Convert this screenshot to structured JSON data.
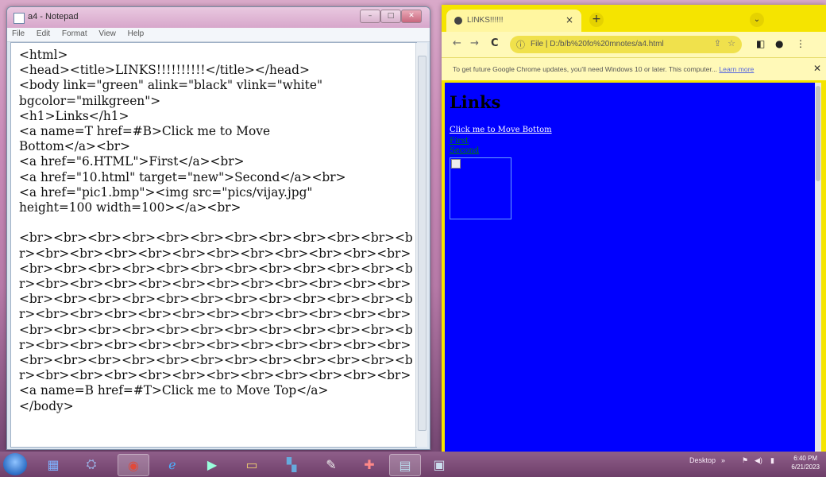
{
  "notepad": {
    "title": "a4 - Notepad",
    "menu": [
      "File",
      "Edit",
      "Format",
      "View",
      "Help"
    ],
    "controls": [
      "–",
      "□",
      "✕"
    ],
    "content": "<html>\n<head><title>LINKS!!!!!!!!!!</title></head>\n<body link=\"green\" alink=\"black\" vlink=\"white\"\nbgcolor=\"milkgreen\">\n<h1>Links</h1>\n<a name=T href=#B>Click me to Move\nBottom</a><br>\n<a href=\"6.HTML\">First</a><br>\n<a href=\"10.html\" target=\"new\">Second</a><br>\n<a href=\"pic1.bmp\"><img src=\"pics/vijay.jpg\"\nheight=100 width=100></a><br>\n\n<br><br><br><br><br><br><br><br><br><br><br><br><br><br><br><br><br><br><br><br><br><br><br><br><br><br><br><br><br><br><br><br><br><br><br><br><br><br><br><br><br><br><br><br><br><br><br><br><br><br><br><br><br><br><br><br><br><br><br><br><br><br><br><br><br><br><br><br><br><br><br><br><br><br><br><br><br><br><br><br><br><br><br><br><br><br><br><br><br><br><br><br><br><br><br><br><br><br><br><br><br><br><br><br><br><br><br><br><br><br><br><br><br><br><br>\n<a name=B href=#T>Click me to Move Top</a>\n</body>"
  },
  "chrome": {
    "tab_title": "LINKS!!!!!!",
    "tab_close": "×",
    "new_tab": "+",
    "menu_chip": "⌄",
    "nav": {
      "back": "←",
      "forward": "→",
      "reload": "C"
    },
    "url": "File | D:/b/b%20fo%20mnotes/a4.html",
    "info_bar": {
      "message": "To get future Google Chrome updates, you'll need Windows 10 or later. This computer...",
      "link": "Learn more",
      "close": "✕"
    },
    "page": {
      "heading": "Links",
      "link_bottom": "Click me to Move Bottom",
      "link_first": "First",
      "link_second": "Second"
    },
    "colors": {
      "frame": "#f5e400",
      "page_bg": "#0000ff",
      "link": "#008000",
      "visited": "#ffffff"
    }
  },
  "taskbar": {
    "apps": [
      "start-orb",
      "explorer",
      "network",
      "chrome",
      "ie",
      "media",
      "folder",
      "windows",
      "paint",
      "tool",
      "notepad",
      "screen"
    ],
    "tray_label": "Desktop",
    "time": "6:40 PM",
    "date": "6/21/2023"
  }
}
